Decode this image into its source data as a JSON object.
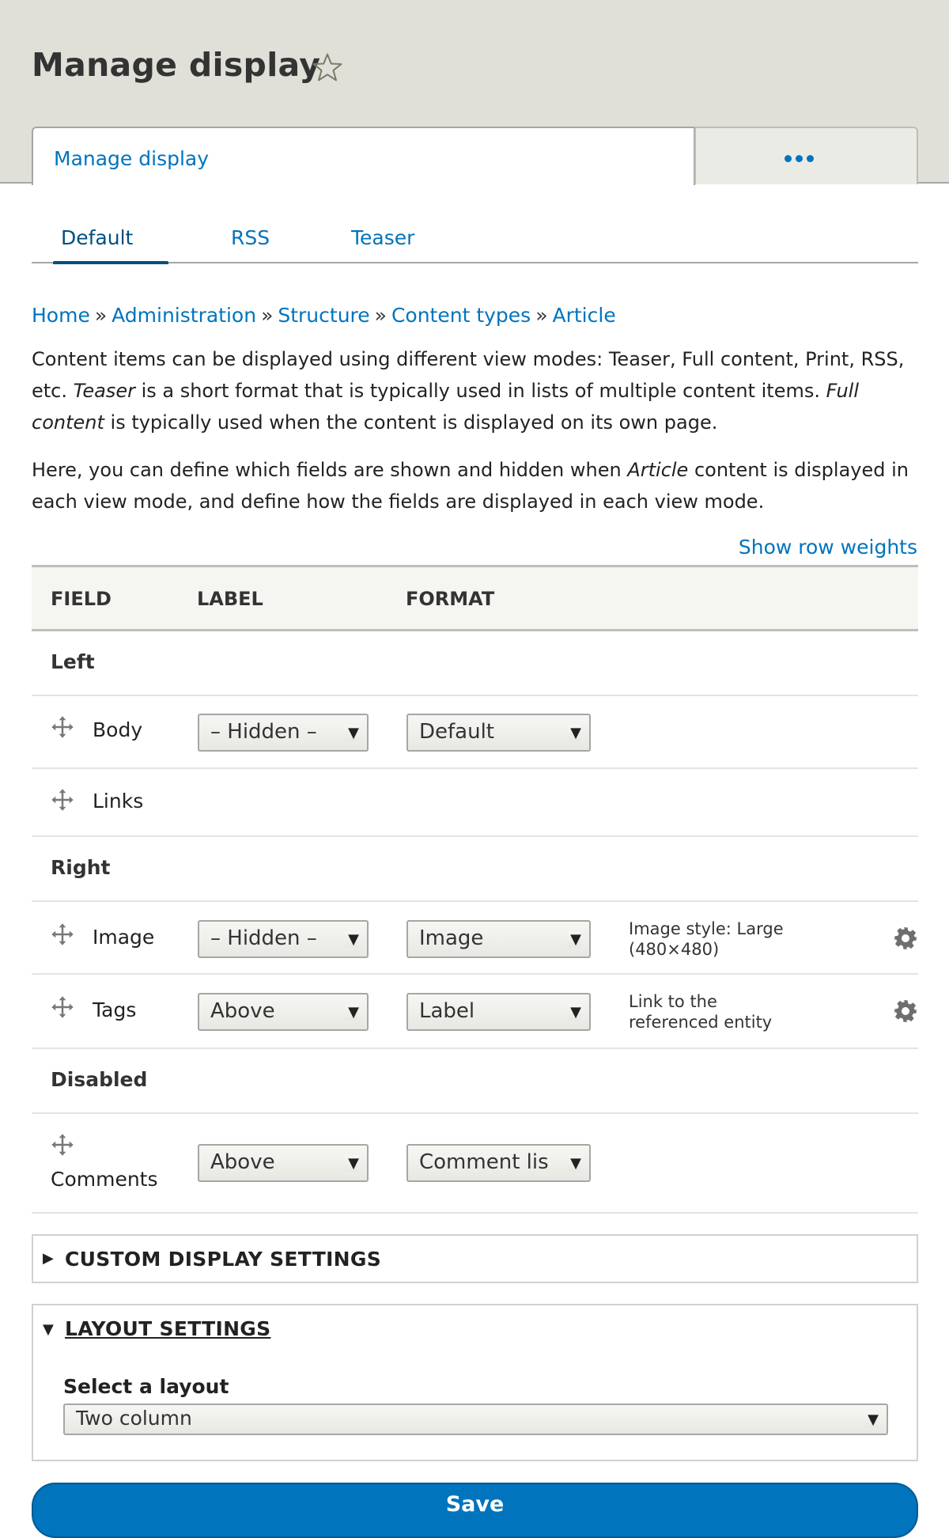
{
  "page": {
    "title": "Manage display",
    "shortcut_icon": "star-outline-icon"
  },
  "primary_tabs": {
    "active_label": "Manage display",
    "more_icon": "ellipsis-icon"
  },
  "secondary_tabs": [
    {
      "label": "Default",
      "active": true
    },
    {
      "label": "RSS",
      "active": false
    },
    {
      "label": "Teaser",
      "active": false
    }
  ],
  "breadcrumb": {
    "items": [
      "Home",
      "Administration",
      "Structure",
      "Content types",
      "Article"
    ],
    "separator": "»"
  },
  "description": {
    "p1_a": "Content items can be displayed using different view modes: Teaser, Full content, Print, RSS, etc. ",
    "p1_em1": "Teaser",
    "p1_b": " is a short format that is typically used in lists of multiple content items. ",
    "p1_em2": "Full content",
    "p1_c": " is typically used when the content is displayed on its own page.",
    "p2_a": "Here, you can define which fields are shown and hidden when ",
    "p2_em": "Article",
    "p2_b": " content is displayed in each view mode, and define how the fields are displayed in each view mode."
  },
  "show_row_weights": "Show row weights",
  "table": {
    "headers": [
      "FIELD",
      "LABEL",
      "FORMAT"
    ],
    "regions": [
      {
        "name": "Left"
      },
      {
        "name": "Right"
      },
      {
        "name": "Disabled"
      }
    ],
    "rows": [
      {
        "field": "Body",
        "label": "– Hidden –",
        "format": "Default",
        "summary": "",
        "has_settings": false
      },
      {
        "field": "Links",
        "label": "",
        "format": "",
        "summary": "",
        "has_settings": false
      },
      {
        "field": "Image",
        "label": "– Hidden –",
        "format": "Image",
        "summary": "Image style: Large (480×480)",
        "summary_line1": "Image style: Large",
        "summary_line2": "(480×480)",
        "has_settings": true
      },
      {
        "field": "Tags",
        "label": "Above",
        "format": "Label",
        "summary": "Link to the referenced entity",
        "summary_line1": "Link to the",
        "summary_line2": "referenced entity",
        "has_settings": true
      },
      {
        "field": "Comments",
        "label": "Above",
        "format": "Comment list",
        "format_visible": "Comment lis",
        "summary": "",
        "has_settings": false
      }
    ]
  },
  "custom_display_settings": {
    "title": "CUSTOM DISPLAY SETTINGS",
    "expanded": false
  },
  "layout_settings": {
    "title": "LAYOUT SETTINGS",
    "expanded": true,
    "select_label": "Select a layout",
    "select_value": "Two column"
  },
  "save_label": "Save",
  "colors": {
    "link": "#0074bd",
    "active_tab": "#004f80",
    "header_bg": "#e0e0d8",
    "primary_button": "#0074bd"
  }
}
